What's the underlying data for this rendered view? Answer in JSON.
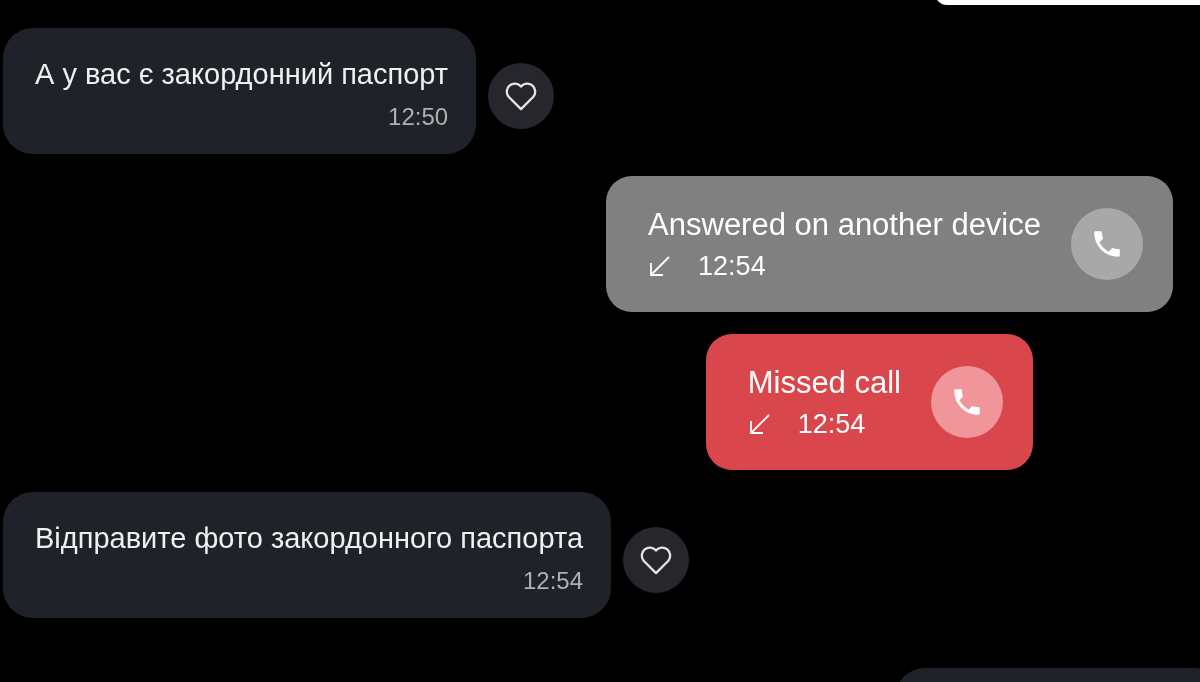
{
  "messages": [
    {
      "kind": "text",
      "text": "А у вас є закордонний паспорт",
      "time": "12:50"
    },
    {
      "kind": "call",
      "text": "Answered on another device",
      "time": "12:54",
      "missed": false
    },
    {
      "kind": "call",
      "text": "Missed call",
      "time": "12:54",
      "missed": true
    },
    {
      "kind": "text",
      "text": "Відправите фото закордонного паспорта",
      "time": "12:54"
    }
  ]
}
